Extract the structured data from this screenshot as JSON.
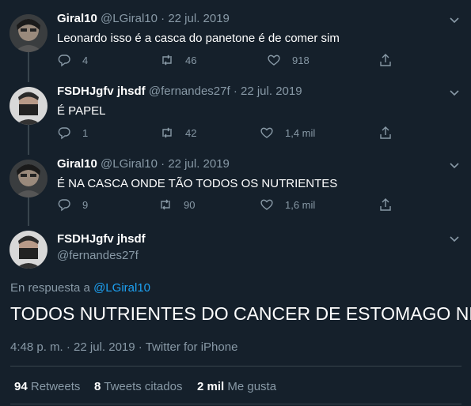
{
  "tweets": [
    {
      "name": "Giral10",
      "handle": "@LGiral10",
      "sep": "·",
      "date": "22 jul. 2019",
      "text": "Leonardo isso é a casca do panetone é de comer sim",
      "replies": "4",
      "retweets": "46",
      "likes": "918"
    },
    {
      "name": "FSDHJgfv jhsdf",
      "handle": "@fernandes27f",
      "sep": "·",
      "date": "22 jul. 2019",
      "text": "É PAPEL",
      "replies": "1",
      "retweets": "42",
      "likes": "1,4 mil"
    },
    {
      "name": "Giral10",
      "handle": "@LGiral10",
      "sep": "·",
      "date": "22 jul. 2019",
      "text": "É NA CASCA ONDE TÃO TODOS OS NUTRIENTES",
      "replies": "9",
      "retweets": "90",
      "likes": "1,6 mil"
    }
  ],
  "main": {
    "name": "FSDHJgfv jhsdf",
    "handle": "@fernandes27f",
    "reply_prefix": "En respuesta a",
    "reply_handle": "@LGiral10",
    "text": "TODOS NUTRIENTES DO CANCER DE ESTOMAGO NÉ?",
    "time": "4:48 p. m.",
    "sep1": "·",
    "date": "22 jul. 2019",
    "sep2": "·",
    "client": "Twitter for iPhone",
    "retweets_count": "94",
    "retweets_label": "Retweets",
    "quotes_count": "8",
    "quotes_label": "Tweets citados",
    "likes_count": "2 mil",
    "likes_label": "Me gusta"
  },
  "colors": {
    "background": "#15202b",
    "muted": "#8899a6",
    "link": "#1da1f2",
    "divider": "#38444d"
  }
}
